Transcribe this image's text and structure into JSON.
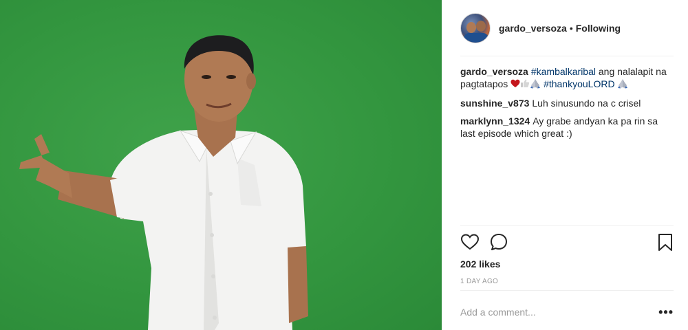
{
  "post": {
    "username": "gardo_versoza",
    "separator": "•",
    "follow_status": "Following"
  },
  "comments": [
    {
      "username": "gardo_versoza",
      "parts": [
        {
          "type": "tag",
          "text": "#kambalkaribal"
        },
        {
          "type": "text",
          "text": " ang nalalapit na pagtatapos "
        },
        {
          "type": "emoji",
          "name": "red-heart-icon"
        },
        {
          "type": "emoji",
          "name": "thumbs-up-icon"
        },
        {
          "type": "emoji",
          "name": "praying-hands-icon"
        },
        {
          "type": "text",
          "text": " "
        },
        {
          "type": "tag",
          "text": "#thankyouLORD"
        },
        {
          "type": "text",
          "text": " "
        },
        {
          "type": "emoji",
          "name": "praying-hands-icon"
        }
      ]
    },
    {
      "username": "sunshine_v873",
      "parts": [
        {
          "type": "text",
          "text": "Luh sinusundo na c crisel"
        }
      ]
    },
    {
      "username": "marklynn_1324",
      "parts": [
        {
          "type": "text",
          "text": "Ay grabe andyan ka pa rin sa last episode which great :)"
        }
      ]
    }
  ],
  "actions": {
    "icons": [
      "heart-icon",
      "comment-icon",
      "bookmark-icon"
    ]
  },
  "likes_text": "202 likes",
  "date_text": "1 DAY AGO",
  "add_comment": {
    "placeholder": "Add a comment...",
    "more_label": "•••"
  },
  "colors": {
    "background_green": "#33963f",
    "hashtag": "#003569",
    "muted": "#999999"
  }
}
